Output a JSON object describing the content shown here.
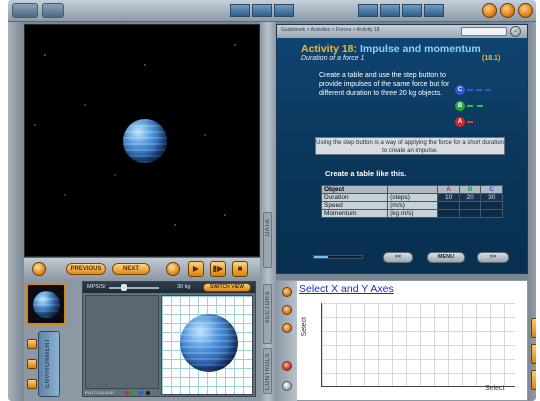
{
  "activity": {
    "breadcrumb": "Guidebook > Activities > Forces > Activity 18",
    "title_prefix": "Activity 18:",
    "title_main": "Impulse and momentum",
    "subtitle": "Duration of a force 1",
    "number": "(18.1)",
    "instructions": "Create a table and use the step button to provide impulses of the same force but for different duration to three 20 kg objects.",
    "badges": [
      {
        "letter": "C",
        "color": "#2f57d8",
        "arrow_color": "#2f57d8"
      },
      {
        "letter": "B",
        "color": "#25a63b",
        "arrow_color": "#2ec24a"
      },
      {
        "letter": "A",
        "color": "#d62a24",
        "arrow_color": "#e03a2c"
      }
    ],
    "note": "Using the step button is a way of applying the force for a short duration to create an impulse.",
    "create_heading": "Create a table like this.",
    "progress": 0.3
  },
  "table": {
    "header": [
      "Object",
      "",
      "A",
      "B",
      "C"
    ],
    "header_colors": [
      "#000000",
      "#000000",
      "#d62a24",
      "#25a63b",
      "#2f57d8"
    ],
    "rows": [
      {
        "label": "Duration",
        "unit": "(steps)",
        "values": [
          "10",
          "20",
          "30"
        ]
      },
      {
        "label": "Speed",
        "unit": "(m/s)",
        "values": [
          "",
          "",
          ""
        ]
      },
      {
        "label": "Momentum",
        "unit": "(kg m/s)",
        "values": [
          "",
          "",
          ""
        ]
      }
    ]
  },
  "nav": {
    "back_label": "<<",
    "menu_label": "MENU",
    "next_label": ">>"
  },
  "controls": {
    "previous_label": "PREVIOUS",
    "next_label": "NEXT"
  },
  "graph": {
    "link_text": "Select X and Y Axes",
    "y_label": "Select",
    "x_label": "Select"
  },
  "vector_panel": {
    "label": "MPS/S/",
    "value": "30 kg",
    "button_label": "SWITCH VIEW",
    "footer": "PLOT COLOUR"
  },
  "tabs": {
    "vectors": "VECTORS",
    "controls": "CONTROLS",
    "data": "DATA",
    "environment": "ENVIRONMENT"
  }
}
